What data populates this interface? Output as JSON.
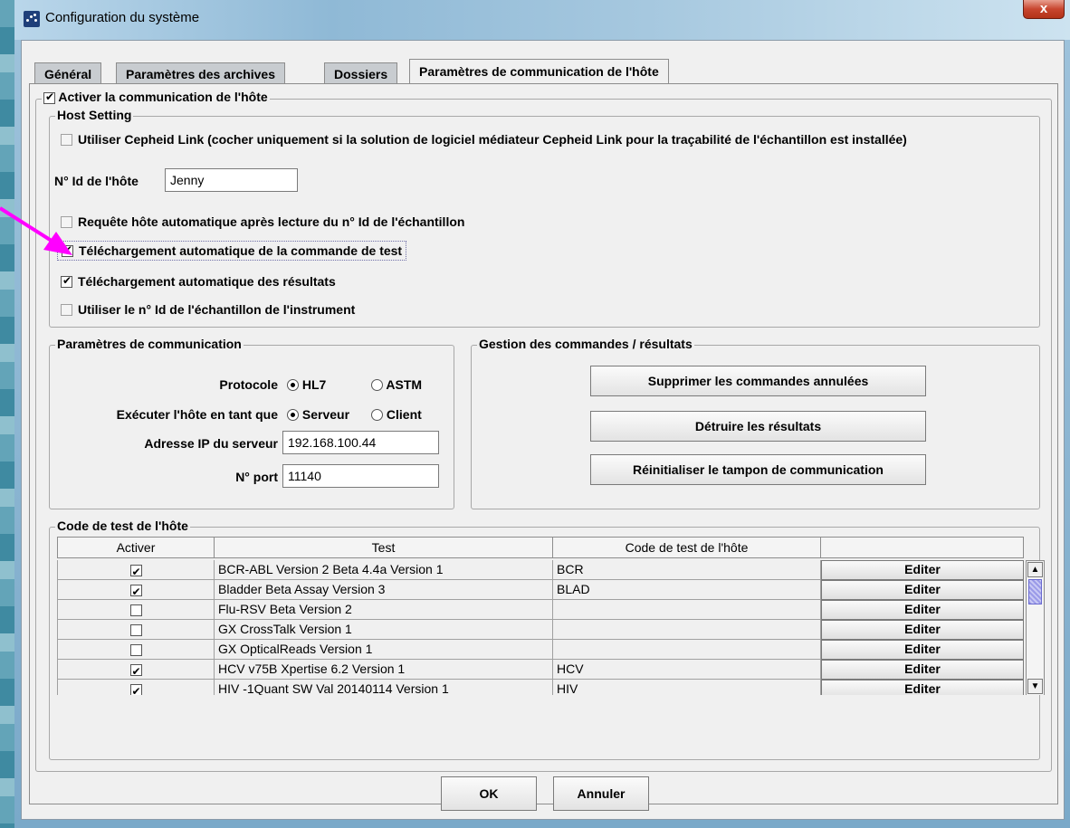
{
  "window": {
    "title": "Configuration du système",
    "close_glyph": "x"
  },
  "tabs": [
    {
      "label": "Général"
    },
    {
      "label": "Paramètres des archives"
    },
    {
      "label": "Dossiers"
    },
    {
      "label": "Paramètres de communication de l'hôte",
      "active": true
    }
  ],
  "enable_comm": {
    "label": "Activer la communication de l'hôte",
    "checked": true
  },
  "host_setting": {
    "legend": "Host Setting",
    "cepheid_link": {
      "label": "Utiliser Cepheid Link (cocher uniquement si la solution de logiciel médiateur Cepheid Link pour la traçabilité de l'échantillon est installée)",
      "checked": false
    },
    "host_id_label": "N° Id de l'hôte",
    "host_id_value": "Jenny",
    "options": [
      {
        "label": "Requête hôte automatique après lecture du n° Id de l'échantillon",
        "checked": false
      },
      {
        "label": "Téléchargement automatique de la commande de test",
        "checked": true
      },
      {
        "label": "Téléchargement automatique des résultats",
        "checked": true
      },
      {
        "label": "Utiliser le n° Id de l'échantillon de l'instrument",
        "checked": false
      }
    ]
  },
  "comm_params": {
    "legend": "Paramètres de communication",
    "protocol_label": "Protocole",
    "protocol_options": [
      "HL7",
      "ASTM"
    ],
    "protocol_selected": "HL7",
    "run_as_label": "Exécuter l'hôte en tant que",
    "run_as_options": [
      "Serveur",
      "Client"
    ],
    "run_as_selected": "Serveur",
    "ip_label": "Adresse IP du serveur",
    "ip_value": "192.168.100.44",
    "port_label": "N° port",
    "port_value": "11140"
  },
  "order_mgmt": {
    "legend": "Gestion des commandes / résultats",
    "buttons": [
      "Supprimer les commandes annulées",
      "Détruire les résultats",
      "Réinitialiser le tampon de communication"
    ]
  },
  "test_codes": {
    "legend": "Code de test de l'hôte",
    "columns": [
      "Activer",
      "Test",
      "Code de test de l'hôte",
      ""
    ],
    "rows": [
      {
        "enabled": true,
        "test": "BCR-ABL Version 2 Beta 4.4a Version 1",
        "code": "BCR",
        "action": "Editer"
      },
      {
        "enabled": true,
        "test": "Bladder Beta Assay Version 3",
        "code": "BLAD",
        "action": "Editer"
      },
      {
        "enabled": false,
        "test": "Flu-RSV Beta Version 2",
        "code": "",
        "action": "Editer"
      },
      {
        "enabled": false,
        "test": "GX CrossTalk Version 1",
        "code": "",
        "action": "Editer"
      },
      {
        "enabled": false,
        "test": "GX OpticalReads Version 1",
        "code": "",
        "action": "Editer"
      },
      {
        "enabled": true,
        "test": "HCV v75B Xpertise 6.2 Version 1",
        "code": "HCV",
        "action": "Editer"
      },
      {
        "enabled": true,
        "test": "HIV -1Quant SW Val 20140114 Version 1",
        "code": "HIV",
        "action": "Editer"
      }
    ]
  },
  "footer": {
    "ok": "OK",
    "cancel": "Annuler"
  },
  "annotation_color": "#ff00ff"
}
